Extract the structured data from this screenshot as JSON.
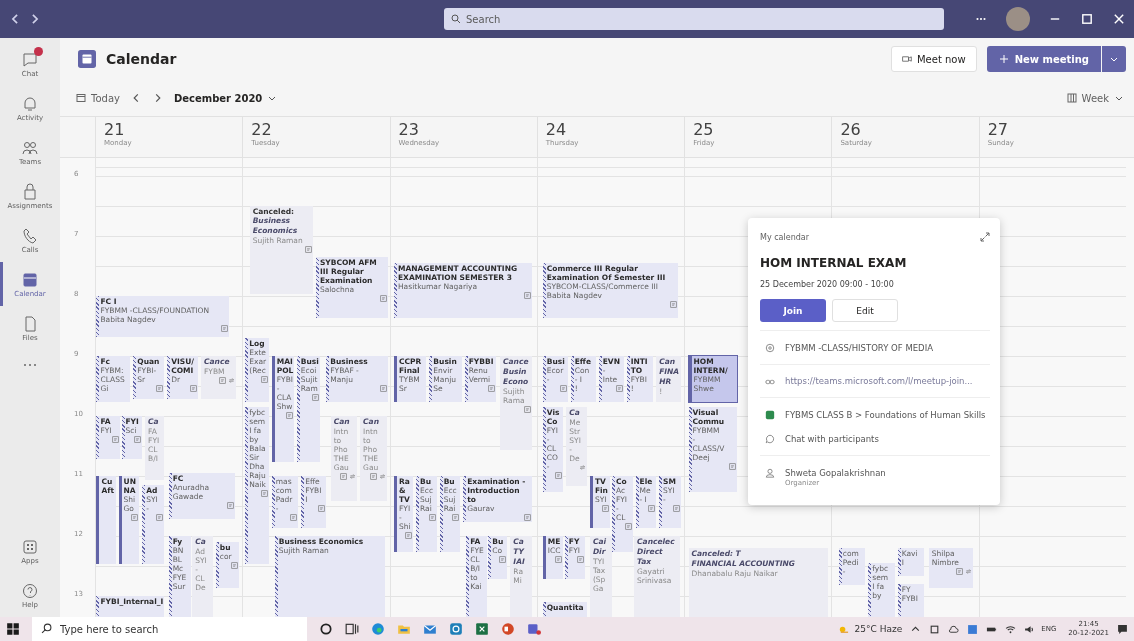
{
  "titlebar": {
    "search_placeholder": "Search"
  },
  "rail": {
    "items": [
      {
        "label": "Chat",
        "selected": false,
        "badge": true
      },
      {
        "label": "Activity",
        "selected": false,
        "badge": false
      },
      {
        "label": "Teams",
        "selected": false,
        "badge": false
      },
      {
        "label": "Assignments",
        "selected": false,
        "badge": false
      },
      {
        "label": "Calls",
        "selected": false,
        "badge": false
      },
      {
        "label": "Calendar",
        "selected": true,
        "badge": false
      },
      {
        "label": "Files",
        "selected": false,
        "badge": false
      }
    ],
    "bottom": [
      {
        "label": "Apps"
      },
      {
        "label": "Help"
      }
    ]
  },
  "header": {
    "title": "Calendar",
    "meet_now": "Meet now",
    "new_meeting": "New meeting"
  },
  "toolbar": {
    "today": "Today",
    "month": "December 2020",
    "view": "Week"
  },
  "hours": [
    "6",
    "7",
    "8",
    "9",
    "10",
    "11",
    "12",
    "13"
  ],
  "days": [
    {
      "number": "21",
      "name": "Monday",
      "events": [
        {
          "kind": "tentative",
          "selected": false,
          "canceled": false,
          "note": true,
          "recurring": false,
          "title": [
            "FC I"
          ],
          "lines": [
            "FYBMM -CLASS/FOUNDATION",
            "Babita Nagdev"
          ]
        },
        {
          "kind": "tentative",
          "selected": false,
          "canceled": false,
          "note": false,
          "recurring": false,
          "title": [
            "Fc"
          ],
          "lines": [
            "FYBM:",
            "CLASS",
            "Gi"
          ]
        },
        {
          "kind": "tentative",
          "selected": false,
          "canceled": false,
          "note": true,
          "recurring": false,
          "title": [
            "Quan"
          ],
          "lines": [
            "FYBI-",
            "Sr"
          ]
        },
        {
          "kind": "tentative",
          "selected": false,
          "canceled": false,
          "note": true,
          "recurring": false,
          "title": [
            "VISU/",
            "COMI"
          ],
          "lines": [
            "Dr"
          ]
        },
        {
          "kind": "busy",
          "selected": false,
          "canceled": true,
          "note": true,
          "recurring": true,
          "title": [
            "Cance"
          ],
          "lines": [
            "FYBM"
          ]
        },
        {
          "kind": "tentative",
          "selected": false,
          "canceled": false,
          "note": true,
          "recurring": false,
          "title": [
            "FA"
          ],
          "lines": [
            "FYI"
          ]
        },
        {
          "kind": "tentative",
          "selected": false,
          "canceled": false,
          "note": true,
          "recurring": false,
          "title": [
            "FYI"
          ],
          "lines": [
            "Sci"
          ]
        },
        {
          "kind": "busy",
          "selected": false,
          "canceled": true,
          "note": false,
          "recurring": false,
          "title": [
            "Ca"
          ],
          "lines": [
            "FA",
            "FYI",
            "CL",
            "B/I"
          ]
        },
        {
          "kind": "accent",
          "selected": false,
          "canceled": false,
          "note": false,
          "recurring": false,
          "title": [
            "Cu",
            "Aft"
          ]
        },
        {
          "kind": "accent",
          "selected": false,
          "canceled": false,
          "note": true,
          "recurring": false,
          "title": [
            "UN",
            "NA"
          ],
          "lines": [
            "Shi",
            "Go"
          ]
        },
        {
          "kind": "tentative",
          "selected": false,
          "canceled": false,
          "note": true,
          "recurring": false,
          "title": [
            "Ad"
          ],
          "lines": [
            "SYI",
            "-"
          ]
        },
        {
          "kind": "tentative",
          "selected": false,
          "canceled": false,
          "note": true,
          "recurring": false,
          "title": [
            "FC"
          ],
          "lines": [
            "Anuradha",
            "Gawade"
          ]
        },
        {
          "kind": "tentative",
          "selected": false,
          "canceled": false,
          "note": false,
          "recurring": false,
          "title": [
            "Fy"
          ],
          "lines": [
            "BN",
            "BL",
            "Mc",
            "FYE",
            "Sur"
          ]
        },
        {
          "kind": "busy",
          "selected": false,
          "canceled": true,
          "note": false,
          "recurring": false,
          "title": [
            "Ca"
          ],
          "lines": [
            "Ad",
            "SYI",
            "-",
            "CL",
            "De"
          ]
        },
        {
          "kind": "tentative",
          "selected": false,
          "canceled": false,
          "note": true,
          "recurring": false,
          "title": [
            "bu"
          ],
          "lines": [
            "cor"
          ]
        },
        {
          "kind": "tentative",
          "selected": false,
          "canceled": false,
          "note": false,
          "recurring": false,
          "title": [
            "FYBI_Internal_I"
          ]
        }
      ]
    },
    {
      "number": "22",
      "name": "Tuesday",
      "events": [
        {
          "kind": "busy",
          "selected": false,
          "canceled": true,
          "note": true,
          "recurring": false,
          "prefix": "Canceled:",
          "title": [
            "Business",
            "Economics"
          ],
          "lines": [
            "Sujith Raman"
          ]
        },
        {
          "kind": "tentative",
          "selected": false,
          "canceled": false,
          "note": true,
          "recurring": false,
          "title": [
            "SYBCOM AFM",
            "III Regular",
            "Examination"
          ],
          "lines": [
            "Salochna"
          ]
        },
        {
          "kind": "tentative",
          "selected": false,
          "canceled": false,
          "note": true,
          "recurring": false,
          "title": [
            "Log"
          ],
          "lines": [
            "Exte",
            "Exar",
            "(Rec"
          ]
        },
        {
          "kind": "tentative",
          "selected": false,
          "canceled": false,
          "note": true,
          "recurring": false,
          "lines": [
            "fybc",
            "sem",
            "I fa",
            "by",
            "Bala",
            "Sir",
            "Dha",
            "Raju",
            "Naik"
          ]
        },
        {
          "kind": "accent",
          "selected": false,
          "canceled": false,
          "note": true,
          "recurring": false,
          "title": [
            "MAI",
            "POL"
          ],
          "lines": [
            "FYBI",
            "-",
            "CLA",
            "Shw"
          ]
        },
        {
          "kind": "tentative",
          "selected": false,
          "canceled": false,
          "note": true,
          "recurring": false,
          "title": [
            "Busi"
          ],
          "lines": [
            "Ecoi",
            "Sujit",
            "Ram"
          ]
        },
        {
          "kind": "tentative",
          "selected": false,
          "canceled": false,
          "note": true,
          "recurring": false,
          "title": [
            "Business"
          ],
          "lines": [
            "FYBAF -",
            "Manju"
          ]
        },
        {
          "kind": "busy",
          "selected": false,
          "canceled": true,
          "note": true,
          "recurring": true,
          "title": [
            "Can"
          ],
          "lines": [
            "Intn",
            "to",
            "Pho",
            "THE",
            "Gau"
          ]
        },
        {
          "kind": "busy",
          "selected": false,
          "canceled": true,
          "note": true,
          "recurring": true,
          "title": [
            "Can"
          ],
          "lines": [
            "Intn",
            "to",
            "Pho",
            "THE",
            "Gau"
          ]
        },
        {
          "kind": "tentative",
          "selected": false,
          "canceled": false,
          "note": true,
          "recurring": false,
          "lines": [
            "mas",
            "com",
            "Padr",
            "-"
          ]
        },
        {
          "kind": "tentative",
          "selected": false,
          "canceled": false,
          "note": true,
          "recurring": false,
          "lines": [
            "Effe",
            "FYBI",
            "I"
          ]
        },
        {
          "kind": "tentative",
          "selected": false,
          "canceled": false,
          "note": false,
          "recurring": false,
          "title": [
            "Business Economics"
          ],
          "lines": [
            "Sujith Raman"
          ]
        }
      ]
    },
    {
      "number": "23",
      "name": "Wednesday",
      "events": [
        {
          "kind": "tentative",
          "selected": false,
          "canceled": false,
          "note": true,
          "recurring": false,
          "title": [
            "MANAGEMENT ACCOUNTING",
            "EXAMINATION SEMESTER 3"
          ],
          "lines": [
            "Hasitkumar Nagariya"
          ]
        },
        {
          "kind": "accent",
          "selected": false,
          "canceled": false,
          "note": false,
          "recurring": false,
          "title": [
            "CCPR",
            "Final"
          ],
          "lines": [
            "TYBM",
            "Sr"
          ]
        },
        {
          "kind": "tentative",
          "selected": false,
          "canceled": false,
          "note": false,
          "recurring": false,
          "title": [
            "Busin"
          ],
          "lines": [
            "Envir",
            "Manju",
            "Se"
          ]
        },
        {
          "kind": "tentative",
          "selected": false,
          "canceled": false,
          "note": true,
          "recurring": false,
          "title": [
            "FYBBI"
          ],
          "lines": [
            "Renu",
            "Vermi"
          ]
        },
        {
          "kind": "busy",
          "selected": false,
          "canceled": true,
          "note": true,
          "recurring": false,
          "title": [
            "Cance",
            "Busin",
            "Econo"
          ],
          "lines": [
            "Sujith",
            "Rama"
          ]
        },
        {
          "kind": "accent",
          "selected": false,
          "canceled": false,
          "note": true,
          "recurring": false,
          "title": [
            "Ra",
            "&",
            "TV"
          ],
          "lines": [
            "FYI",
            "-",
            "Shi"
          ]
        },
        {
          "kind": "tentative",
          "selected": false,
          "canceled": false,
          "note": true,
          "recurring": false,
          "title": [
            "Bu"
          ],
          "lines": [
            "Ecc",
            "Suj",
            "Rai"
          ]
        },
        {
          "kind": "tentative",
          "selected": false,
          "canceled": false,
          "note": true,
          "recurring": false,
          "title": [
            "Bu"
          ],
          "lines": [
            "Ecc",
            "Suj",
            "Rai"
          ]
        },
        {
          "kind": "tentative",
          "selected": false,
          "canceled": false,
          "note": true,
          "recurring": false,
          "title": [
            "Examination -",
            "Introduction",
            "to"
          ],
          "lines": [
            "Gaurav"
          ]
        },
        {
          "kind": "tentative",
          "selected": false,
          "canceled": false,
          "note": false,
          "recurring": false,
          "title": [
            "FA"
          ],
          "lines": [
            "FYE",
            "CL",
            "B/I",
            "to",
            "Kai"
          ]
        },
        {
          "kind": "tentative",
          "selected": false,
          "canceled": false,
          "note": true,
          "recurring": false,
          "title": [
            "Bu"
          ],
          "lines": [
            "Co"
          ]
        },
        {
          "kind": "busy",
          "selected": false,
          "canceled": true,
          "note": false,
          "recurring": false,
          "title": [
            "Ca",
            "TY",
            "IAI"
          ],
          "lines": [
            "Ra",
            "Mi"
          ]
        }
      ]
    },
    {
      "number": "24",
      "name": "Thursday",
      "events": [
        {
          "kind": "tentative",
          "selected": false,
          "canceled": false,
          "note": true,
          "recurring": false,
          "title": [
            "Commerce III Regular",
            "Examination Of Semester III"
          ],
          "lines": [
            "SYBCOM-CLASS/Commerce III",
            "Babita Nagdev"
          ]
        },
        {
          "kind": "tentative",
          "selected": false,
          "canceled": false,
          "note": true,
          "recurring": false,
          "title": [
            "Busi"
          ],
          "lines": [
            "Ecor",
            "-"
          ]
        },
        {
          "kind": "tentative",
          "selected": false,
          "canceled": false,
          "note": false,
          "recurring": false,
          "title": [
            "Effe"
          ],
          "lines": [
            "Con",
            "- I",
            "!"
          ]
        },
        {
          "kind": "tentative",
          "selected": false,
          "canceled": false,
          "note": true,
          "recurring": false,
          "title": [
            "EVN"
          ],
          "lines": [
            "-",
            "Inte"
          ]
        },
        {
          "kind": "tentative",
          "selected": false,
          "canceled": false,
          "note": false,
          "recurring": false,
          "title": [
            "INTI",
            "TO"
          ],
          "lines": [
            "FYBI",
            "!"
          ]
        },
        {
          "kind": "busy",
          "selected": false,
          "canceled": true,
          "note": false,
          "recurring": false,
          "title": [
            "Can",
            "FINA",
            "HR"
          ],
          "lines": [
            "!"
          ]
        },
        {
          "kind": "tentative",
          "selected": false,
          "canceled": false,
          "note": true,
          "recurring": false,
          "title": [
            "Vis",
            "Co"
          ],
          "lines": [
            "FYI",
            "-",
            "CL",
            "CO",
            "-"
          ]
        },
        {
          "kind": "busy",
          "selected": false,
          "canceled": true,
          "note": false,
          "recurring": true,
          "title": [
            "Ca"
          ],
          "lines": [
            "Me",
            "Str",
            "SYI",
            "-",
            "De"
          ]
        },
        {
          "kind": "accent",
          "selected": false,
          "canceled": false,
          "note": true,
          "recurring": false,
          "title": [
            "TV",
            "Fin"
          ],
          "lines": [
            "SYI"
          ]
        },
        {
          "kind": "tentative",
          "selected": false,
          "canceled": false,
          "note": true,
          "recurring": false,
          "title": [
            "Co"
          ],
          "lines": [
            "Ac",
            "FYI",
            "-",
            "CL"
          ]
        },
        {
          "kind": "tentative",
          "selected": false,
          "canceled": false,
          "note": true,
          "recurring": false,
          "title": [
            "Ele"
          ],
          "lines": [
            "Me",
            "- I"
          ]
        },
        {
          "kind": "tentative",
          "selected": false,
          "canceled": false,
          "note": true,
          "recurring": false,
          "title": [
            "SM"
          ],
          "lines": [
            "SYI",
            "-"
          ]
        },
        {
          "kind": "accent",
          "selected": false,
          "canceled": false,
          "note": true,
          "recurring": false,
          "title": [
            "ME"
          ],
          "lines": [
            "ICC"
          ]
        },
        {
          "kind": "tentative",
          "selected": false,
          "canceled": false,
          "note": true,
          "recurring": false,
          "title": [
            "FY"
          ],
          "lines": [
            "FYI"
          ]
        },
        {
          "kind": "busy",
          "selected": false,
          "canceled": true,
          "note": false,
          "recurring": false,
          "title": [
            "Cai",
            "Dir"
          ],
          "lines": [
            "TYI",
            "Tax",
            "(Sp",
            "Ga"
          ]
        },
        {
          "kind": "busy",
          "selected": false,
          "canceled": true,
          "note": false,
          "recurring": false,
          "title": [
            "Cancelec",
            "Direct",
            "Tax"
          ],
          "lines": [
            "Gayatri",
            "Srinivasa"
          ]
        },
        {
          "kind": "tentative",
          "selected": false,
          "canceled": false,
          "note": false,
          "recurring": false,
          "title": [
            "Quantita"
          ]
        }
      ]
    },
    {
      "number": "25",
      "name": "Friday",
      "events": [
        {
          "kind": "accent",
          "selected": true,
          "canceled": false,
          "note": false,
          "recurring": false,
          "title": [
            "HOM",
            "INTERN/"
          ],
          "lines": [
            "FYBMM",
            "Shwe"
          ]
        },
        {
          "kind": "tentative",
          "selected": false,
          "canceled": false,
          "note": true,
          "recurring": false,
          "title": [
            "Visual",
            "Commu"
          ],
          "lines": [
            "FYBMM",
            "-",
            "CLASS/V",
            "Deej"
          ]
        },
        {
          "kind": "busy",
          "selected": false,
          "canceled": true,
          "note": false,
          "recurring": false,
          "title": [
            "Canceled: T",
            "FINANCIAL ACCOUNTING"
          ],
          "lines": [
            "Dhanabalu Raju Naikar"
          ]
        }
      ]
    },
    {
      "number": "26",
      "name": "Saturday",
      "events": [
        {
          "kind": "tentative",
          "selected": false,
          "canceled": false,
          "note": false,
          "recurring": false,
          "lines": [
            "com",
            "Pedi",
            "-"
          ]
        },
        {
          "kind": "tentative",
          "selected": false,
          "canceled": false,
          "note": false,
          "recurring": false,
          "lines": [
            "fybc",
            "sem",
            "I fa",
            "by"
          ]
        },
        {
          "kind": "tentative",
          "selected": false,
          "canceled": false,
          "note": false,
          "recurring": false,
          "lines": [
            "Kavi",
            "I"
          ]
        },
        {
          "kind": "tentative",
          "selected": false,
          "canceled": false,
          "note": false,
          "recurring": false,
          "lines": [
            "FY",
            "FYBI"
          ]
        },
        {
          "kind": "busy",
          "selected": false,
          "canceled": false,
          "note": true,
          "recurring": true,
          "lines": [
            "Shilpa",
            "Nimbre"
          ]
        }
      ]
    },
    {
      "number": "27",
      "name": "Sunday"
    }
  ],
  "popup": {
    "calendar": "My calendar",
    "title": "HOM INTERNAL EXAM",
    "when": "25 December 2020 09:00 - 10:00",
    "buttons": [
      "Join",
      "Edit"
    ],
    "details": [
      {
        "kind": "channel",
        "text": "FYBMM -CLASS/HISTORY OF MEDIA"
      },
      {
        "kind": "link",
        "text": "https://teams.microsoft.com/l/meetup-join..."
      },
      {
        "kind": "team",
        "text": "FYBMS CLASS B > Foundations of Human Skills"
      },
      {
        "kind": "chat",
        "text": "Chat with participants"
      },
      {
        "kind": "person",
        "text": "Shweta Gopalakrishnan",
        "sub": "Organizer"
      }
    ]
  },
  "taskbar": {
    "search_placeholder": "Type here to search",
    "weather": "25°C Haze",
    "language": "ENG",
    "time": "21:45",
    "date": "20-12-2021"
  }
}
